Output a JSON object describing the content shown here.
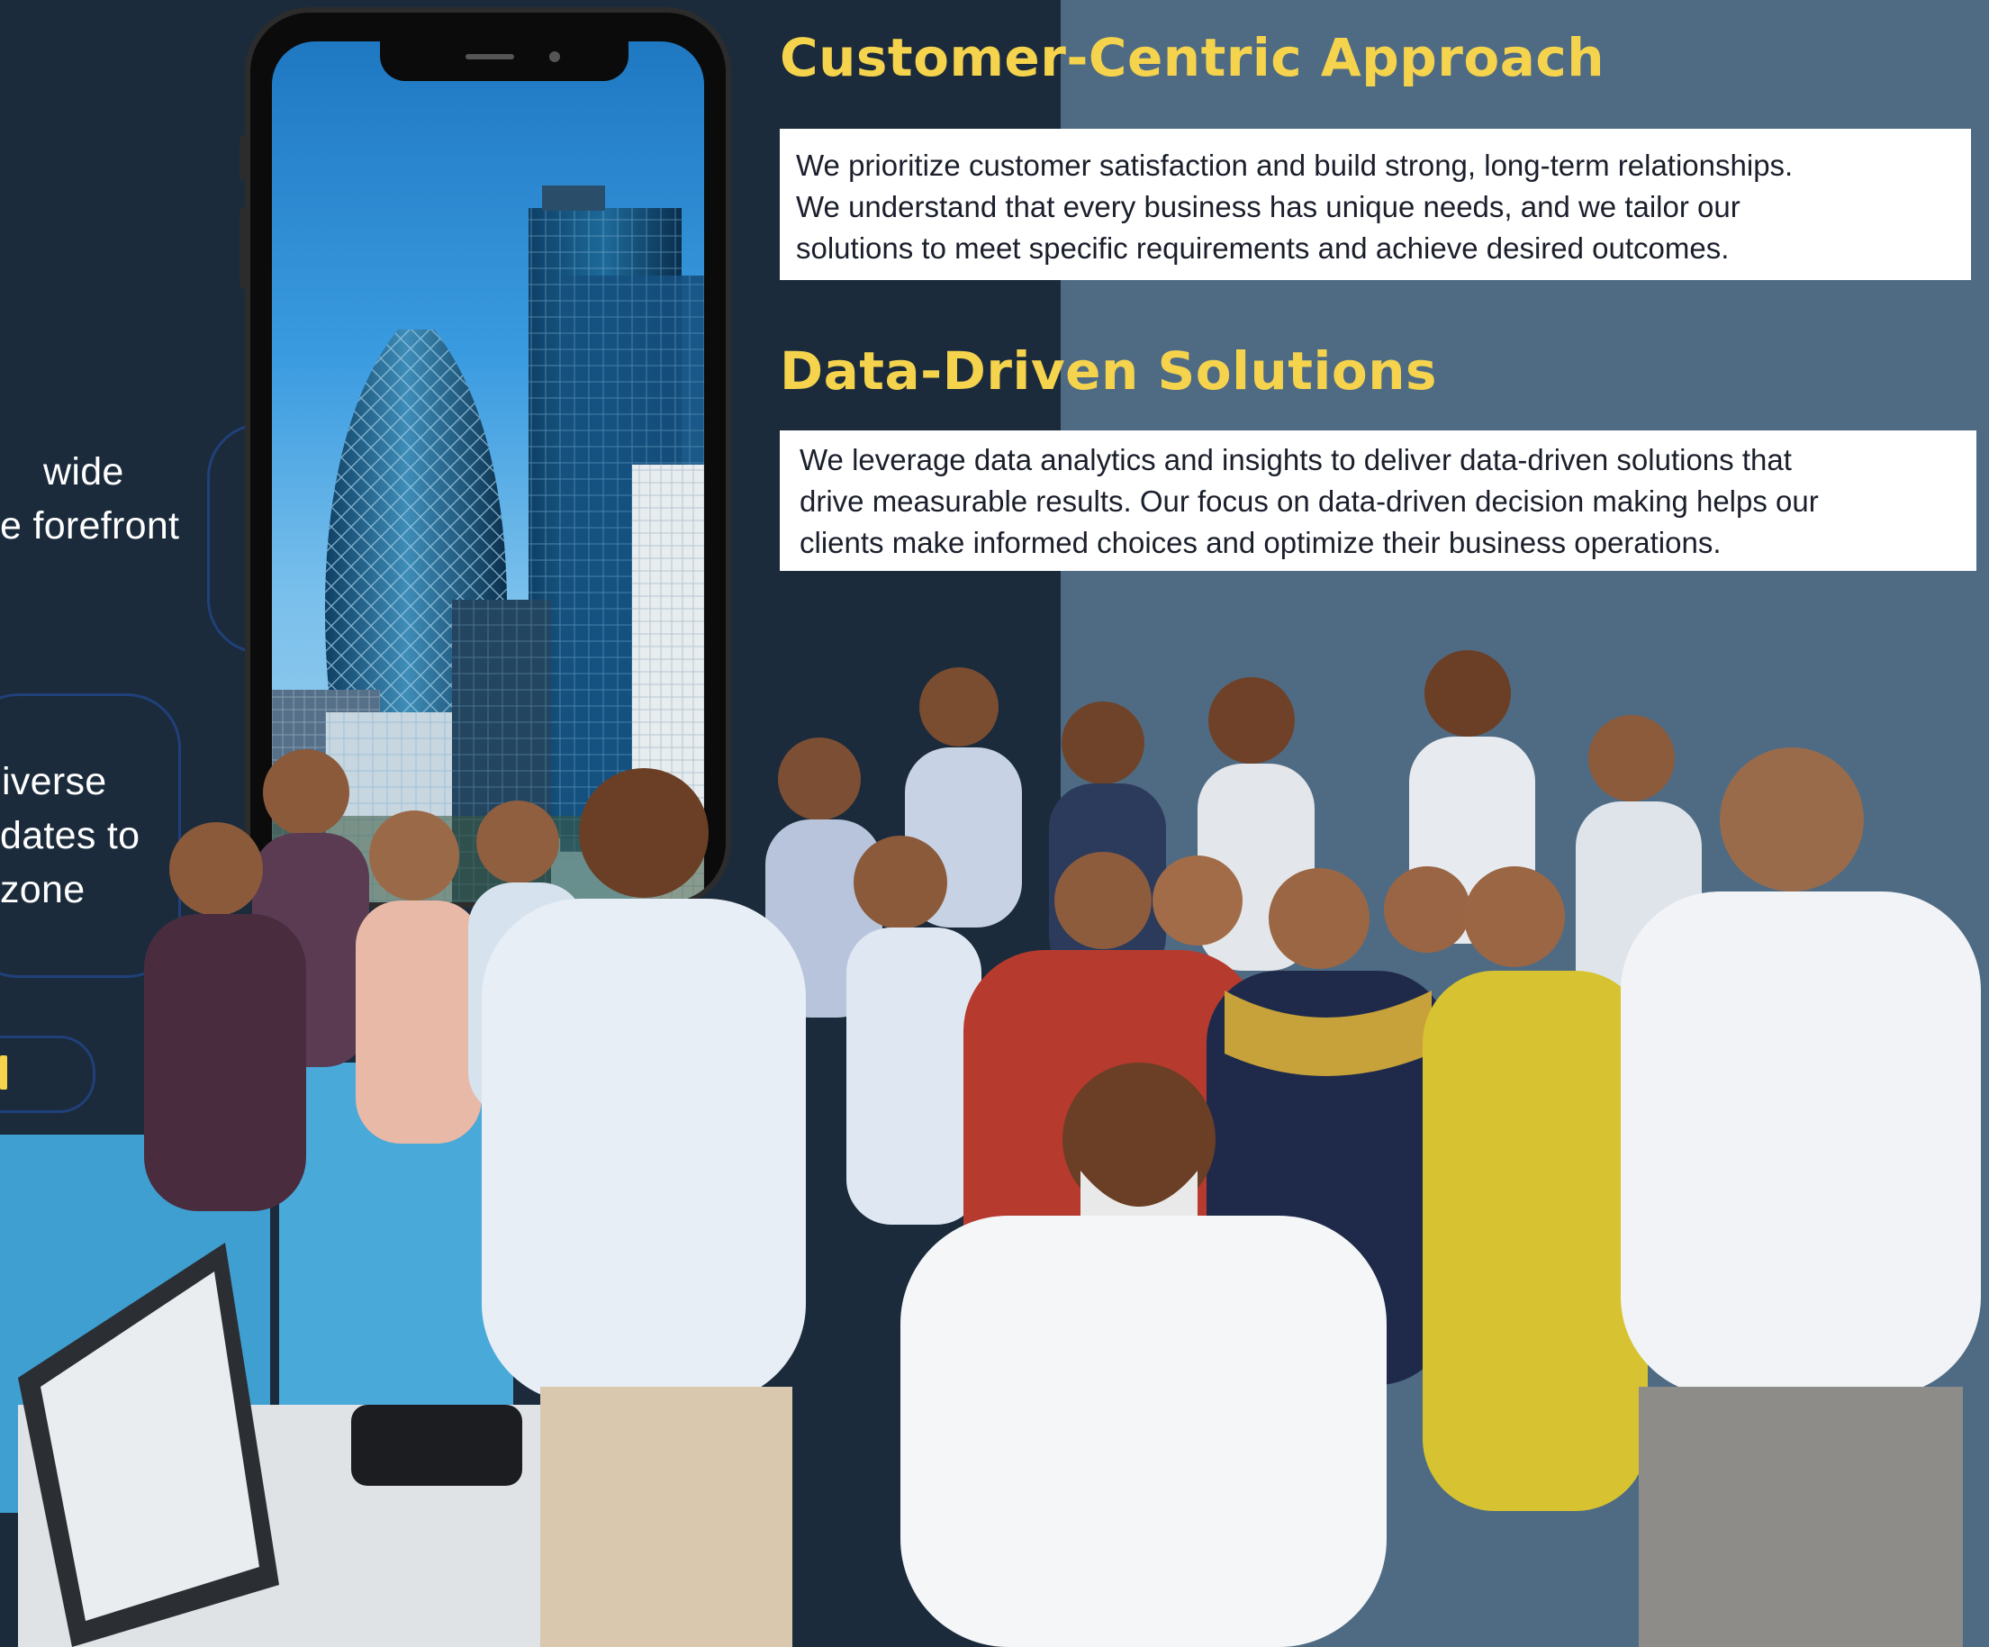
{
  "left_panel": {
    "text_block_1": [
      "wide",
      "e forefront"
    ],
    "text_block_2": [
      "iverse",
      "dates to",
      "zone"
    ]
  },
  "phone": {
    "screen_image": "city-skyline-gherkin-tower"
  },
  "sections": [
    {
      "heading": "Customer-Centric Approach",
      "lines": [
        "We prioritize customer satisfaction and build strong, long-term relationships.",
        "We understand that every business has unique needs, and we tailor our",
        "solutions to meet specific requirements and achieve desired outcomes."
      ]
    },
    {
      "heading": "Data-Driven Solutions",
      "lines": [
        "We leverage data analytics and insights to deliver data-driven solutions that",
        "drive measurable results. Our focus on data-driven decision making helps our",
        "clients make informed choices and optimize their business operations."
      ]
    }
  ],
  "photo": {
    "subject": "team-group-photo"
  },
  "colors": {
    "dark_navy": "#1b2b3b",
    "steel_blue": "#4f6b84",
    "accent_yellow": "#f5d34d",
    "text_white": "#ffffff",
    "text_dark": "#1a1f2b"
  }
}
